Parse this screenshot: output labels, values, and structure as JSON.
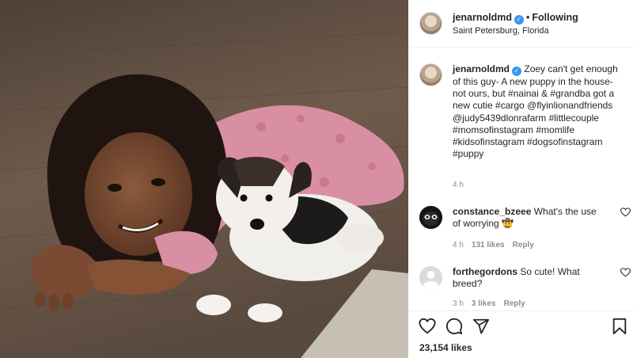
{
  "post": {
    "username": "jenarnoldmd",
    "verified_mark": "✓",
    "separator": "•",
    "follow_state": "Following",
    "location": "Saint Petersburg, Florida"
  },
  "caption": {
    "username": "jenarnoldmd",
    "text": "Zoey can't get enough of this guy- A new puppy in the house- not ours, but #nainai & #grandba got a new cutie #cargo @flyinlionandfriends @judy5439dlonrafarm #littlecouple #momsofinstagram #momlife #kidsofinstagram #dogsofinstagram #puppy",
    "time": "4 h"
  },
  "comments": [
    {
      "username": "constance_bzeee",
      "text": "What's the use of worrying 🤠",
      "time": "4 h",
      "likes": "131 likes",
      "reply": "Reply",
      "avatar_icon": "dark-creature-avatar"
    },
    {
      "username": "forthegordons",
      "text": "So cute! What breed?",
      "time": "3 h",
      "likes": "3 likes",
      "reply": "Reply",
      "avatar_icon": "default-user-avatar"
    }
  ],
  "footer": {
    "likes_count": "23,154 likes",
    "icons": [
      "heart-icon",
      "comment-icon",
      "share-icon",
      "bookmark-icon"
    ]
  },
  "colors": {
    "verified": "#3897f0",
    "text": "#262626",
    "secondary": "#8e8e8e"
  }
}
